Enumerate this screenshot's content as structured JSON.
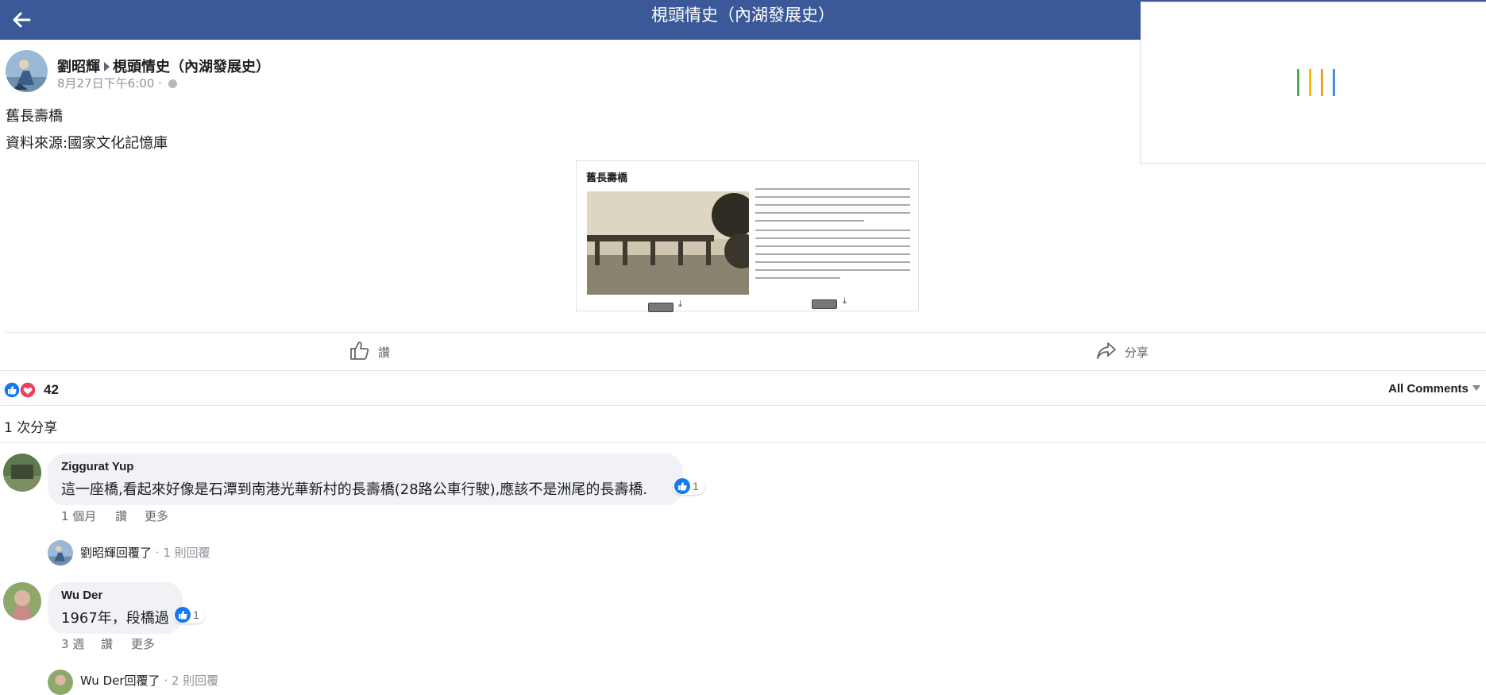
{
  "header": {
    "title": "梘頭情史（內湖發展史）"
  },
  "post": {
    "author": "劉昭輝",
    "group": "梘頭情史（內湖發展史）",
    "timestamp": "8月27日下午6:00 ·",
    "lines": [
      "舊長壽橋",
      "資料來源:國家文化記憶庫"
    ],
    "attachment": {
      "title": "舊長壽橋",
      "download_glyph": "⤓"
    }
  },
  "actions": {
    "like": "讚",
    "share": "分享"
  },
  "reactions": {
    "count": "42",
    "all_comments": "All Comments"
  },
  "share_count": "1 次分享",
  "comments": [
    {
      "name": "Ziggurat Yup",
      "text": "這一座橋,看起來好像是石潭到南港光華新村的長壽橋(28路公車行駛),應該不是洲尾的長壽橋.",
      "likes": "1",
      "time": "1 個月",
      "like": "讚",
      "more": "更多",
      "reply_author": "劉昭輝",
      "reply_label": "回覆了",
      "reply_count": " · 1 則回覆"
    },
    {
      "name": "Wu Der",
      "text": "1967年，段橋過",
      "likes": "1",
      "time": "3 週",
      "like": "讚",
      "more": "更多",
      "reply_author": "Wu Der",
      "reply_label": "回覆了",
      "reply_count": " · 2 則回覆"
    }
  ],
  "colors": {
    "brand": "#3b5998",
    "like_blue": "#1877f2",
    "love_red": "#f33e58"
  }
}
